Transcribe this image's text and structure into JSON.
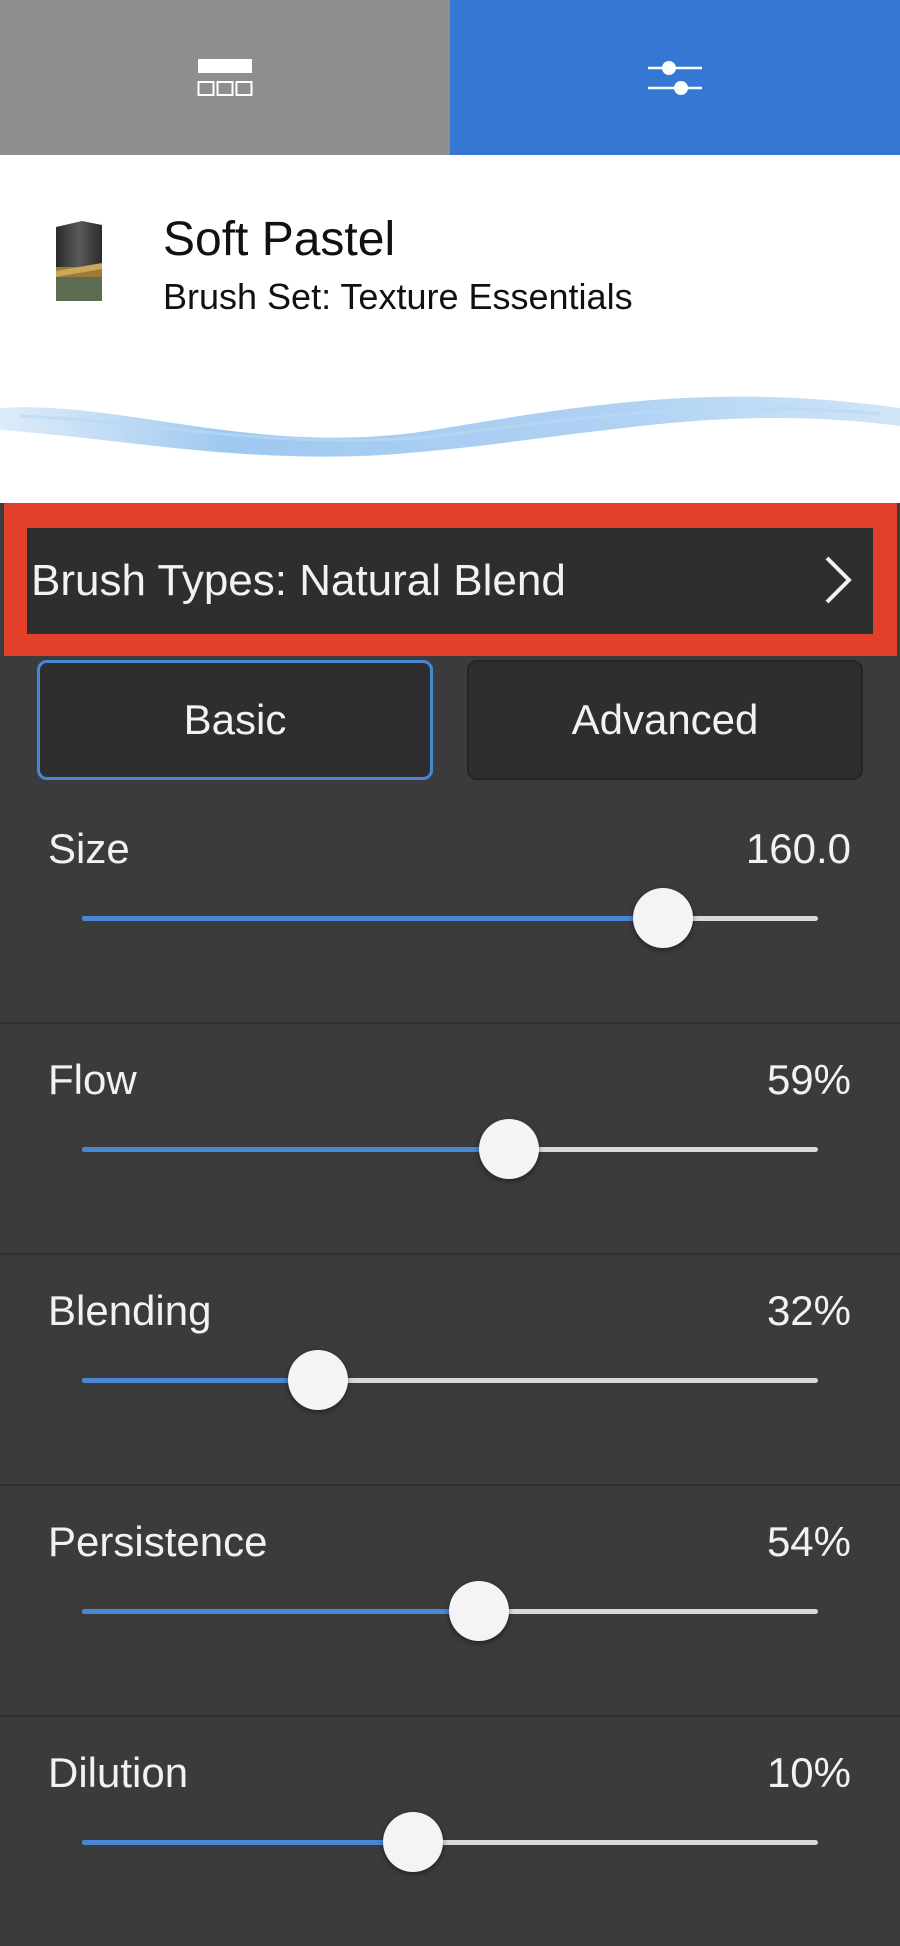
{
  "tabs": {
    "brushes_icon": "brush-grid-icon",
    "settings_icon": "sliders-icon",
    "active": "settings",
    "colors": {
      "inactive": "#8e8e8e",
      "active": "#3578d4"
    }
  },
  "header": {
    "brush_name": "Soft Pastel",
    "brush_set": "Brush Set: Texture Essentials"
  },
  "brush_types": {
    "label": "Brush Types: Natural Blend",
    "highlight_color": "#e2402a"
  },
  "modes": {
    "basic_label": "Basic",
    "advanced_label": "Advanced",
    "selected": "Basic"
  },
  "sliders": [
    {
      "label": "Size",
      "value": "160.0",
      "fraction": 0.79
    },
    {
      "label": "Flow",
      "value": "59%",
      "fraction": 0.58
    },
    {
      "label": "Blending",
      "value": "32%",
      "fraction": 0.32
    },
    {
      "label": "Persistence",
      "value": "54%",
      "fraction": 0.54
    },
    {
      "label": "Dilution",
      "value": "10%",
      "fraction": 0.45
    }
  ],
  "colors": {
    "accent": "#4a86d6",
    "panel": "#3b3b3c"
  }
}
